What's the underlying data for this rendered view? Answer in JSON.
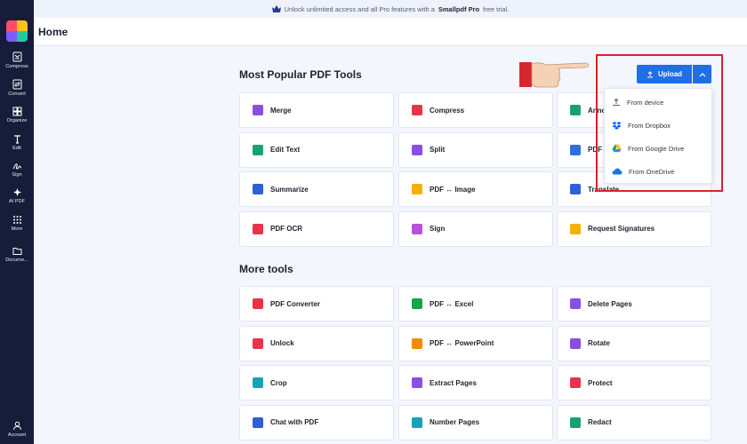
{
  "banner": {
    "prefix": "Unlock unlimited access and all Pro features with a",
    "brand": "Smallpdf Pro",
    "suffix": "free trial."
  },
  "header": {
    "title": "Home"
  },
  "sidebar": {
    "items": [
      {
        "label": "Compress",
        "icon": "compress-icon"
      },
      {
        "label": "Convert",
        "icon": "convert-icon"
      },
      {
        "label": "Organize",
        "icon": "organize-icon"
      },
      {
        "label": "Edit",
        "icon": "edit-icon"
      },
      {
        "label": "Sign",
        "icon": "sign-icon"
      },
      {
        "label": "AI PDF",
        "icon": "ai-icon"
      },
      {
        "label": "More",
        "icon": "more-icon"
      },
      {
        "label": "Docume...",
        "icon": "folder-icon"
      },
      {
        "label": "Account",
        "icon": "account-icon"
      }
    ]
  },
  "popular": {
    "title": "Most Popular PDF Tools",
    "tools": [
      {
        "label": "Merge",
        "color": "#8a4fe0"
      },
      {
        "label": "Compress",
        "color": "#e8334a"
      },
      {
        "label": "Annot",
        "color": "#16a374"
      },
      {
        "label": "Edit Text",
        "color": "#16a374"
      },
      {
        "label": "Split",
        "color": "#8a4fe0"
      },
      {
        "label": "PDF",
        "color": "#2f6fdb"
      },
      {
        "label": "Summarize",
        "color": "#2f5fd8"
      },
      {
        "label": "PDF ↔ Image",
        "color": "#f2b203"
      },
      {
        "label": "Translate",
        "color": "#2f5fd8"
      },
      {
        "label": "PDF OCR",
        "color": "#e8334a"
      },
      {
        "label": "Sign",
        "color": "#b553d6"
      },
      {
        "label": "Request Signatures",
        "color": "#f2b203"
      }
    ]
  },
  "more": {
    "title": "More tools",
    "tools": [
      {
        "label": "PDF Converter",
        "color": "#e8334a"
      },
      {
        "label": "PDF ↔ Excel",
        "color": "#16a34a"
      },
      {
        "label": "Delete Pages",
        "color": "#8a4fe0"
      },
      {
        "label": "Unlock",
        "color": "#e8334a"
      },
      {
        "label": "PDF ↔ PowerPoint",
        "color": "#f08a0a"
      },
      {
        "label": "Rotate",
        "color": "#8a4fe0"
      },
      {
        "label": "Crop",
        "color": "#17a2b8"
      },
      {
        "label": "Extract Pages",
        "color": "#8a4fe0"
      },
      {
        "label": "Protect",
        "color": "#e8334a"
      },
      {
        "label": "Chat with PDF",
        "color": "#2f5fd8"
      },
      {
        "label": "Number Pages",
        "color": "#17a2b8"
      },
      {
        "label": "Redact",
        "color": "#16a374"
      }
    ]
  },
  "upload": {
    "label": "Upload",
    "options": [
      {
        "label": "From device",
        "icon": "upload-icon"
      },
      {
        "label": "From Dropbox",
        "icon": "dropbox-icon"
      },
      {
        "label": "From Google Drive",
        "icon": "google-drive-icon"
      },
      {
        "label": "From OneDrive",
        "icon": "onedrive-icon"
      }
    ]
  },
  "colors": {
    "accent": "#1f6fe5",
    "sidebar": "#161d3a",
    "highlight": "#e0202a"
  }
}
